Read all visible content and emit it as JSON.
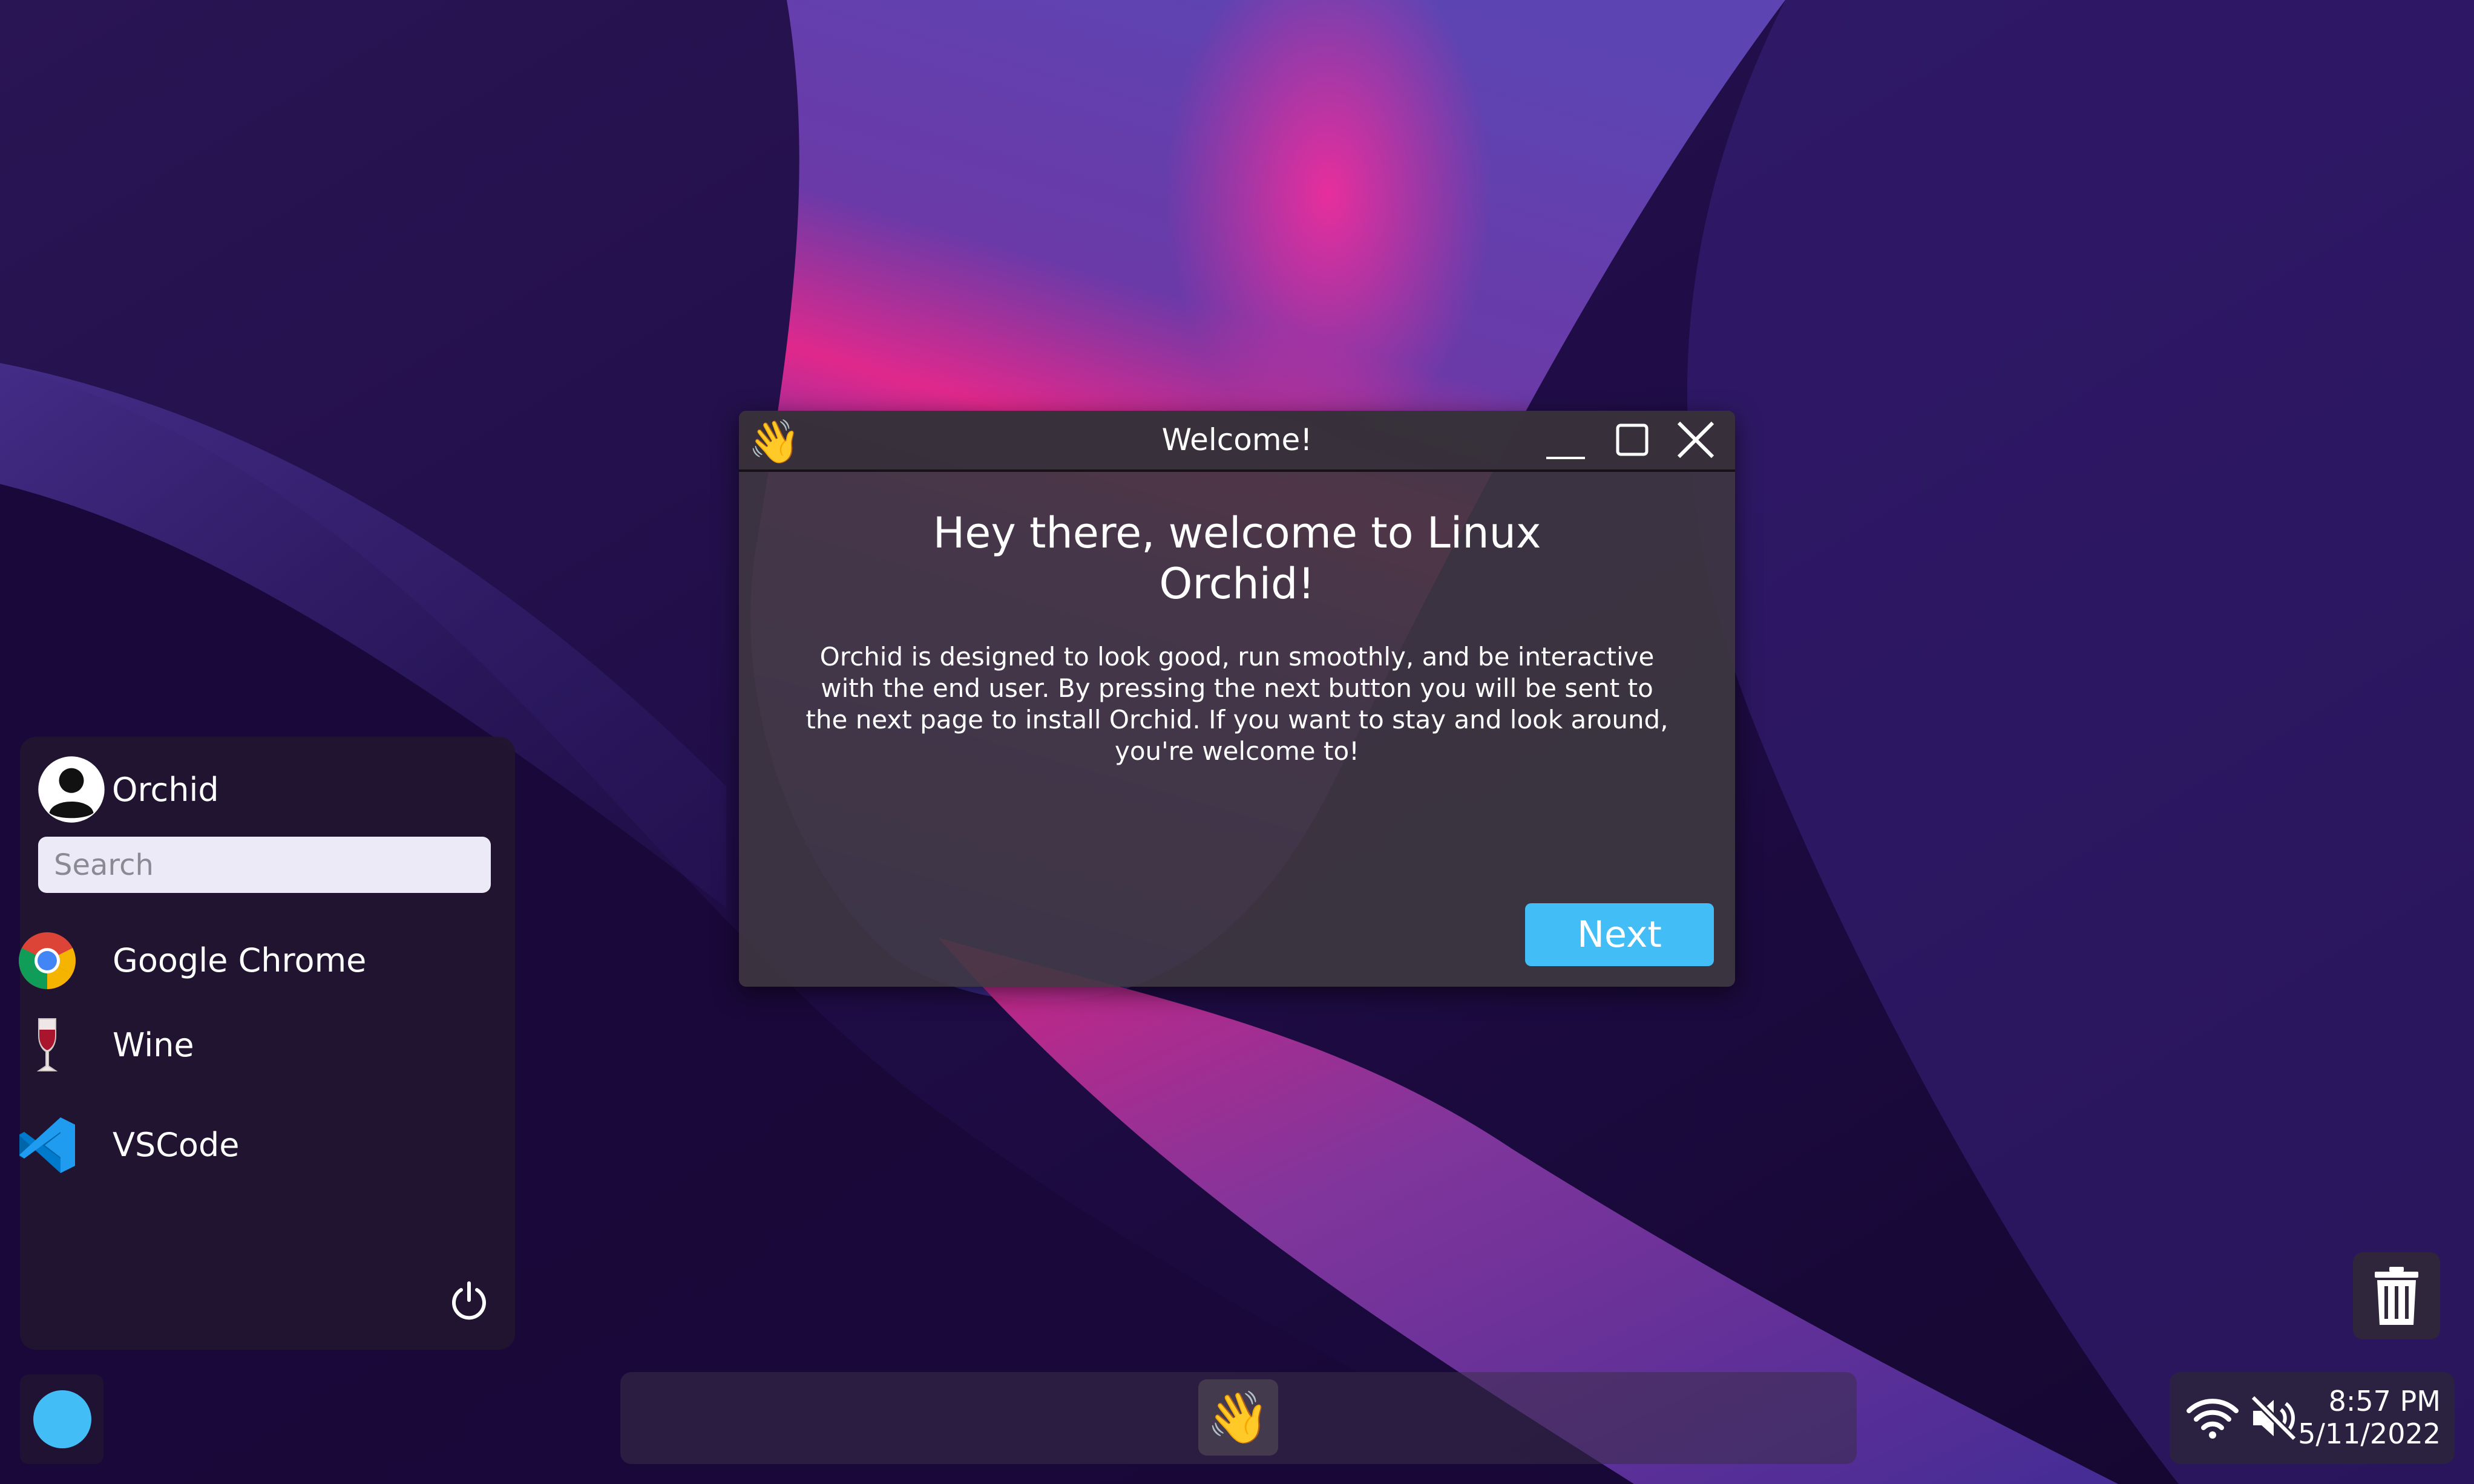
{
  "window": {
    "title": "Welcome!",
    "icon": "waving-hand-icon",
    "icon_glyph": "👋",
    "heading": "Hey there, welcome to Linux Orchid!",
    "body": "Orchid is designed to look good, run smoothly, and be interactive with the end user. By pressing the next button you will be sent to the next page to install Orchid. If you want to stay and look around, you're welcome to!",
    "next_label": "Next"
  },
  "start_menu": {
    "user_name": "Orchid",
    "search_placeholder": "Search",
    "apps": [
      {
        "label": "Google Chrome",
        "icon": "chrome-icon"
      },
      {
        "label": "Wine",
        "icon": "wine-glass-icon"
      },
      {
        "label": "VSCode",
        "icon": "vscode-icon"
      }
    ]
  },
  "taskbar": {
    "running_app_glyph": "👋",
    "running_app_icon": "waving-hand-icon"
  },
  "tray": {
    "time": "8:57 PM",
    "date": "5/11/2022",
    "wifi": "connected",
    "volume": "muted"
  },
  "colors": {
    "accent": "#42bdf5",
    "panel": "#221630",
    "window": "#3e3740"
  }
}
